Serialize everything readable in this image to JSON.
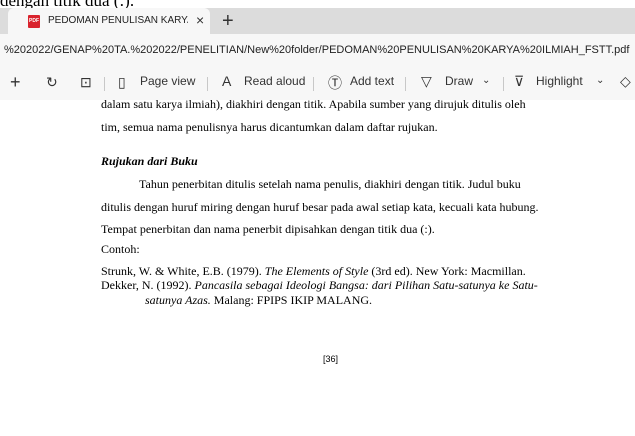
{
  "background_text": "dengan titik dua (:).",
  "tab": {
    "title": "PEDOMAN PENULISAN KARYA IL",
    "pdf_icon": "PDF",
    "close_glyph": "×"
  },
  "new_tab_glyph": "+",
  "url": "%202022/GENAP%20TA.%202022/PENELITIAN/New%20folder/PEDOMAN%20PENULISAN%20KARYA%20ILMIAH_FSTT.pdf",
  "toolbar": {
    "page_view": "Page view",
    "read_aloud": "Read aloud",
    "add_text": "Add text",
    "draw": "Draw",
    "highlight": "Highlight",
    "icons": [
      "add-icon",
      "rotate-icon",
      "fit-page-icon",
      "page-view-icon",
      "read-aloud-icon",
      "add-text-icon",
      "draw-icon",
      "highlight-icon",
      "eraser-icon"
    ]
  },
  "document": {
    "line1": "dalam satu karya ilmiah), diakhiri dengan titik. Apabila sumber yang dirujuk ditulis oleh",
    "line2": "tim, semua nama penulisnya harus dicantumkan dalam daftar rujukan.",
    "heading": "Rujukan dari Buku",
    "para1": "Tahun penerbitan ditulis setelah nama penulis, diakhiri dengan titik. Judul buku",
    "para2": "ditulis dengan huruf miring dengan huruf besar pada awal setiap kata, kecuali kata hubung.",
    "para3": "Tempat penerbitan dan nama penerbit dipisahkan dengan titik dua (:).",
    "contoh": "Contoh:",
    "ref1_a": "Strunk, W. & White, E.B. (1979). ",
    "ref1_title": "The Elements of Style",
    "ref1_b": " (3rd ed). New York: Macmillan.",
    "ref2_a": "Dekker, N. (1992). ",
    "ref2_title1": "Pancasila sebagai Ideologi Bangsa: dari Pilihan Satu-satunya ke Satu-",
    "ref2_title2": "satunya Azas.",
    "ref2_b": " Malang: FPIPS IKIP MALANG.",
    "page_number": "[36]"
  }
}
